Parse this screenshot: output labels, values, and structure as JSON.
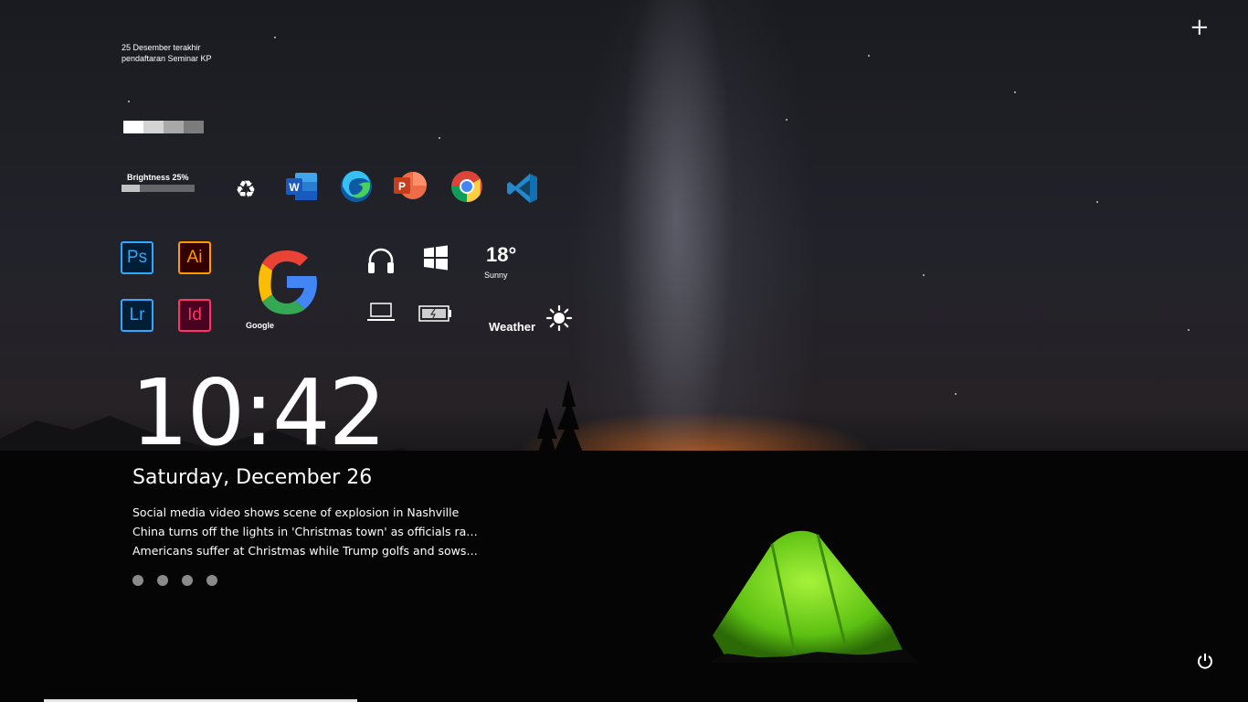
{
  "note": {
    "text": "25 Desember terakhir pendaftaran Seminar KP"
  },
  "swatches": [
    "#ffffff",
    "#d4d4d4",
    "#a8a8a8",
    "#7c7c7c"
  ],
  "brightness": {
    "label": "Brightness 25%",
    "level": 0.25
  },
  "dock_apps": [
    {
      "name": "recycle-bin"
    },
    {
      "name": "microsoft-word"
    },
    {
      "name": "microsoft-edge"
    },
    {
      "name": "microsoft-powerpoint"
    },
    {
      "name": "google-chrome"
    },
    {
      "name": "visual-studio-code"
    }
  ],
  "adobe_apps": [
    {
      "label": "Ps",
      "color": "#31a8ff",
      "bg": "#001e36"
    },
    {
      "label": "Ai",
      "color": "#ff9a00",
      "bg": "#330000"
    },
    {
      "label": "Lr",
      "color": "#31a8ff",
      "bg": "#001e36"
    },
    {
      "label": "Id",
      "color": "#ff3366",
      "bg": "#49021f"
    }
  ],
  "google": {
    "label": "Google"
  },
  "system_icons": [
    "headphones-icon",
    "windows-icon",
    "laptop-icon",
    "battery-icon"
  ],
  "weather": {
    "temp": "18°",
    "condition": "Sunny",
    "label": "Weather"
  },
  "clock": {
    "time": "10:42",
    "date": "Saturday, December 26"
  },
  "news": [
    "Social media video shows scene of explosion in Nashville",
    "China turns off the lights in 'Christmas town' as officials race...",
    "Americans suffer at Christmas while Trump golfs and sows c..."
  ],
  "page_dots": 4,
  "colors": {
    "tent": "#6fd11e",
    "horizon": "#d2641a"
  }
}
